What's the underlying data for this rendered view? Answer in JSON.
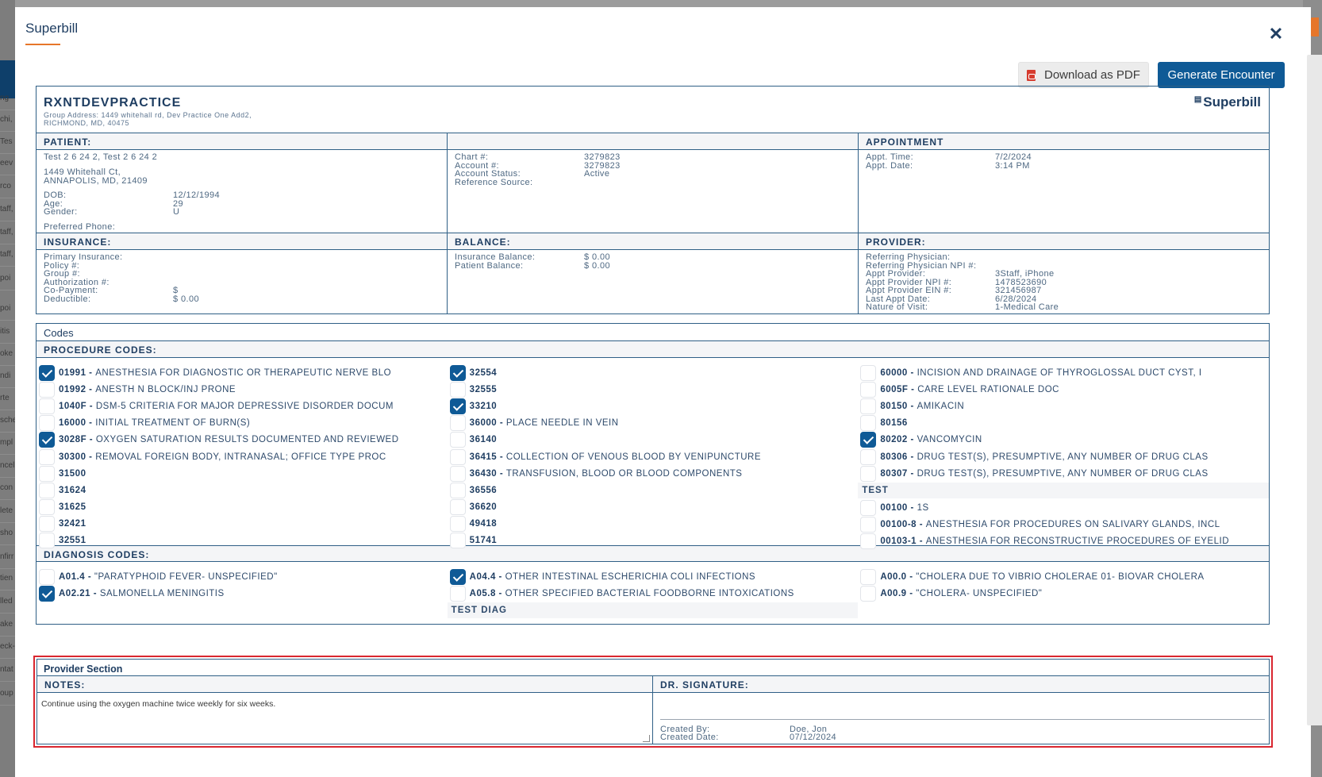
{
  "background": {
    "left_snippets": [
      "ng",
      "chi,",
      "Tes",
      "eev",
      "rco",
      "taff,",
      "taff,",
      "taff,",
      "poi",
      "poi",
      "itis",
      "oke",
      "ndi",
      "rte",
      "sche",
      "mpl",
      "ncel",
      "con",
      "lete",
      "sho",
      "nfirr",
      "tien",
      "lled",
      "ake",
      "eck-",
      "ntat",
      "oup"
    ],
    "left_bar_text": "pi"
  },
  "modal": {
    "title": "Superbill",
    "close_icon": "close-icon",
    "download_label": "Download as PDF",
    "generate_label": "Generate Encounter"
  },
  "practice": {
    "name": "RXNTDEVPRACTICE",
    "address_line1": "Group Address: 1449 whitehall rd, Dev Practice One Add2,",
    "address_line2": "RICHMOND, MD, 40475",
    "brand": "Superbill",
    "brand_icon": "document-icon"
  },
  "patient": {
    "heading": "PATIENT:",
    "name": "Test 2 6 24 2, Test 2 6 24 2",
    "street": "1449 Whitehall Ct,",
    "city": "ANNAPOLIS, MD, 21409",
    "dob_label": "DOB:",
    "dob": "12/12/1994",
    "age_label": "Age:",
    "age": "29",
    "gender_label": "Gender:",
    "gender": "U",
    "phone_label": "Preferred Phone:"
  },
  "chart": {
    "chart_label": "Chart #:",
    "chart": "3279823",
    "account_label": "Account #:",
    "account": "3279823",
    "status_label": "Account Status:",
    "status": "Active",
    "ref_label": "Reference Source:"
  },
  "appointment": {
    "heading": "APPOINTMENT",
    "time_label": "Appt. Time:",
    "time": "7/2/2024",
    "date_label": "Appt. Date:",
    "date": "3:14 PM"
  },
  "insurance": {
    "heading": "INSURANCE:",
    "primary_label": "Primary Insurance:",
    "policy_label": "Policy #:",
    "group_label": "Group #:",
    "auth_label": "Authorization #:",
    "copay_label": "Co-Payment:",
    "copay": "$",
    "deductible_label": "Deductible:",
    "deductible": "$ 0.00"
  },
  "balance": {
    "heading": "BALANCE:",
    "ins_label": "Insurance Balance:",
    "ins": "$ 0.00",
    "pat_label": "Patient Balance:",
    "pat": "$ 0.00"
  },
  "provider": {
    "heading": "PROVIDER:",
    "ref_label": "Referring Physician:",
    "ref_npi_label": "Referring Physician NPI #:",
    "appt_prov_label": "Appt Provider:",
    "appt_prov": "3Staff, iPhone",
    "npi_label": "Appt Provider NPI #:",
    "npi": "1478523690",
    "ein_label": "Appt Provider EIN #:",
    "ein": "321456987",
    "last_label": "Last Appt Date:",
    "last": "6/28/2024",
    "nature_label": "Nature of Visit:",
    "nature": "1-Medical Care"
  },
  "codes": {
    "title": "Codes",
    "procedure_heading": "PROCEDURE CODES:",
    "procedure_cols": [
      [
        {
          "code": "01991",
          "desc": "ANESTHESIA FOR DIAGNOSTIC OR THERAPEUTIC NERVE BLO",
          "checked": true
        },
        {
          "code": "01992",
          "desc": "ANESTH N BLOCK/INJ PRONE",
          "checked": false
        },
        {
          "code": "1040F",
          "desc": "DSM-5 CRITERIA FOR MAJOR DEPRESSIVE DISORDER DOCUM",
          "checked": false
        },
        {
          "code": "16000",
          "desc": "INITIAL TREATMENT OF BURN(S)",
          "checked": false
        },
        {
          "code": "3028F",
          "desc": "OXYGEN SATURATION RESULTS DOCUMENTED AND REVIEWED",
          "checked": true
        },
        {
          "code": "30300",
          "desc": "REMOVAL FOREIGN BODY, INTRANASAL; OFFICE TYPE PROC",
          "checked": false
        },
        {
          "code": "31500",
          "desc": "",
          "checked": false
        },
        {
          "code": "31624",
          "desc": "",
          "checked": false
        },
        {
          "code": "31625",
          "desc": "",
          "checked": false
        },
        {
          "code": "32421",
          "desc": "",
          "checked": false
        },
        {
          "code": "32551",
          "desc": "",
          "checked": false
        }
      ],
      [
        {
          "code": "32554",
          "desc": "",
          "checked": true
        },
        {
          "code": "32555",
          "desc": "",
          "checked": false
        },
        {
          "code": "33210",
          "desc": "",
          "checked": true
        },
        {
          "code": "36000",
          "desc": "PLACE NEEDLE IN VEIN",
          "checked": false
        },
        {
          "code": "36140",
          "desc": "",
          "checked": false
        },
        {
          "code": "36415",
          "desc": "COLLECTION OF VENOUS BLOOD BY VENIPUNCTURE",
          "checked": false
        },
        {
          "code": "36430",
          "desc": "TRANSFUSION, BLOOD OR BLOOD COMPONENTS",
          "checked": false
        },
        {
          "code": "36556",
          "desc": "",
          "checked": false
        },
        {
          "code": "36620",
          "desc": "",
          "checked": false
        },
        {
          "code": "49418",
          "desc": "",
          "checked": false
        },
        {
          "code": "51741",
          "desc": "",
          "checked": false
        }
      ],
      [
        {
          "code": "60000",
          "desc": "INCISION AND DRAINAGE OF THYROGLOSSAL DUCT CYST, I",
          "checked": false
        },
        {
          "code": "6005F",
          "desc": "CARE LEVEL RATIONALE DOC",
          "checked": false
        },
        {
          "code": "80150",
          "desc": "AMIKACIN",
          "checked": false
        },
        {
          "code": "80156",
          "desc": "",
          "checked": false
        },
        {
          "code": "80202",
          "desc": "VANCOMYCIN",
          "checked": true
        },
        {
          "code": "80306",
          "desc": "DRUG TEST(S), PRESUMPTIVE, ANY NUMBER OF DRUG CLAS",
          "checked": false
        },
        {
          "code": "80307",
          "desc": "DRUG TEST(S), PRESUMPTIVE, ANY NUMBER OF DRUG CLAS",
          "checked": false
        },
        {
          "group": "TEST"
        },
        {
          "code": "00100",
          "desc": "1S",
          "checked": false
        },
        {
          "code": "00100-8",
          "desc": "ANESTHESIA FOR PROCEDURES ON SALIVARY GLANDS, INCL",
          "checked": false
        },
        {
          "code": "00103-1",
          "desc": "ANESTHESIA FOR RECONSTRUCTIVE PROCEDURES OF EYELID",
          "checked": false
        }
      ]
    ],
    "diagnosis_heading": "DIAGNOSIS CODES:",
    "diagnosis_cols": [
      [
        {
          "code": "A01.4",
          "desc": "\"PARATYPHOID FEVER- UNSPECIFIED\"",
          "checked": false
        },
        {
          "code": "A02.21",
          "desc": "SALMONELLA MENINGITIS",
          "checked": true
        }
      ],
      [
        {
          "code": "A04.4",
          "desc": "OTHER INTESTINAL ESCHERICHIA COLI INFECTIONS",
          "checked": true
        },
        {
          "code": "A05.8",
          "desc": "OTHER SPECIFIED BACTERIAL FOODBORNE INTOXICATIONS",
          "checked": false
        },
        {
          "group": "TEST DIAG"
        }
      ],
      [
        {
          "code": "A00.0",
          "desc": "\"CHOLERA DUE TO VIBRIO CHOLERAE 01- BIOVAR CHOLERA",
          "checked": false
        },
        {
          "code": "A00.9",
          "desc": "\"CHOLERA- UNSPECIFIED\"",
          "checked": false
        }
      ]
    ]
  },
  "provider_section": {
    "title": "Provider Section",
    "notes_heading": "NOTES:",
    "notes": "Continue using the oxygen machine twice weekly for six weeks.",
    "sig_heading": "DR. SIGNATURE:",
    "created_by_label": "Created By:",
    "created_by": "Doe, Jon",
    "created_date_label": "Created Date:",
    "created_date": "07/12/2024"
  }
}
